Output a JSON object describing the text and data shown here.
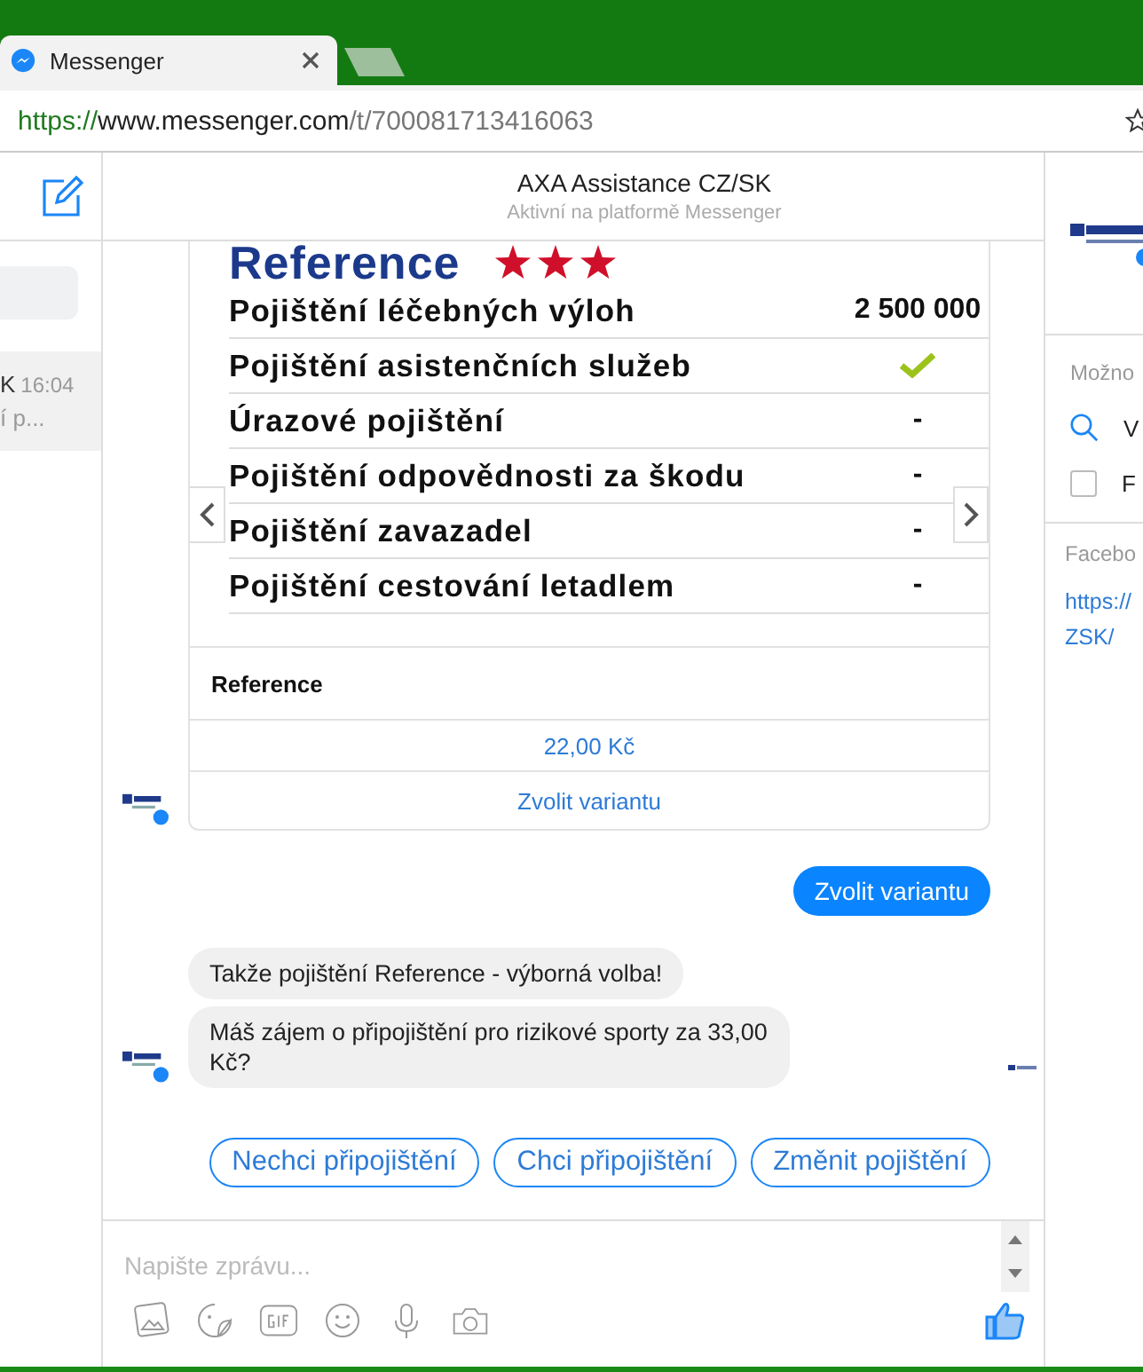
{
  "browser": {
    "tab_title": "Messenger",
    "url_scheme": "https://",
    "url_host": "www.messenger.com",
    "url_path": "/t/700081713416063"
  },
  "sidebar": {
    "conversation": {
      "name": "K",
      "time": "16:04",
      "snippet": "í p..."
    }
  },
  "header": {
    "title": "AXA Assistance CZ/SK",
    "subtitle": "Aktivní na platformě Messenger"
  },
  "card": {
    "heading": "Reference",
    "stars": 3,
    "rows": [
      {
        "label": "Pojištění léčebných výloh",
        "kind": "text",
        "value": "2 500 000"
      },
      {
        "label": "Pojištění asistenčních služeb",
        "kind": "check"
      },
      {
        "label": "Úrazové pojištění",
        "kind": "text",
        "value": "-"
      },
      {
        "label": "Pojištění odpovědnosti za škodu",
        "kind": "text",
        "value": "-"
      },
      {
        "label": "Pojištění zavazadel",
        "kind": "text",
        "value": "-"
      },
      {
        "label": "Pojištění cestování letadlem",
        "kind": "text",
        "value": "-"
      }
    ],
    "title": "Reference",
    "price": "22,00 Kč",
    "button": "Zvolit variantu"
  },
  "messages": [
    {
      "kind": "sent",
      "text": "Zvolit variantu"
    },
    {
      "kind": "received",
      "text": "Takže pojištění Reference - výborná volba!"
    },
    {
      "kind": "received",
      "text": "Máš zájem o připojištění pro rizikové sporty za 33,00 Kč?"
    }
  ],
  "quick_replies": [
    "Nechci připojištění",
    "Chci připojištění",
    "Změnit pojištění"
  ],
  "composer": {
    "placeholder": "Napište zprávu..."
  },
  "right_panel": {
    "section_1": "Možno",
    "search_text": "V",
    "checkbox_text": "F",
    "checked": false,
    "section_2": "Facebo",
    "link_1": "https://",
    "link_2": "ZSK/"
  }
}
